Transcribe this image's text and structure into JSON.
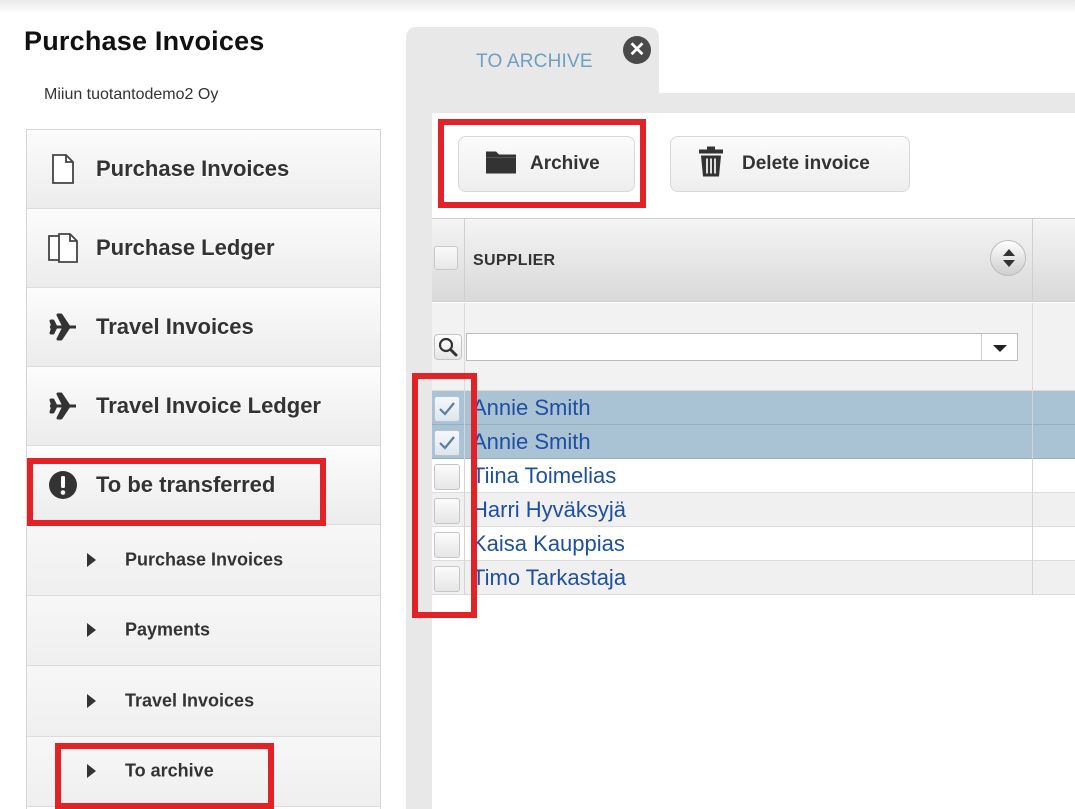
{
  "app": {
    "title": "Purchase Invoices",
    "company": "Miiun tuotantodemo2 Oy"
  },
  "sidebar": {
    "items": [
      {
        "label": "Purchase Invoices",
        "icon": "document-icon"
      },
      {
        "label": "Purchase Ledger",
        "icon": "documents-icon"
      },
      {
        "label": "Travel Invoices",
        "icon": "airplane-icon"
      },
      {
        "label": "Travel Invoice Ledger",
        "icon": "airplane-icon"
      },
      {
        "label": "To be transferred",
        "icon": "exclamation-icon"
      }
    ],
    "subitems": [
      {
        "label": "Purchase Invoices"
      },
      {
        "label": "Payments"
      },
      {
        "label": "Travel Invoices"
      },
      {
        "label": "To archive"
      }
    ]
  },
  "tab": {
    "label": "TO ARCHIVE",
    "close_glyph": "✕"
  },
  "toolbar": {
    "archive_label": "Archive",
    "delete_label": "Delete invoice"
  },
  "grid": {
    "column_header": "SUPPLIER",
    "filter_placeholder": "",
    "rows": [
      {
        "name": "Annie Smith",
        "checked": true
      },
      {
        "name": "Annie Smith",
        "checked": true
      },
      {
        "name": "Tiina Toimelias",
        "checked": false
      },
      {
        "name": "Harri Hyväksyjä",
        "checked": false
      },
      {
        "name": "Kaisa Kauppias",
        "checked": false
      },
      {
        "name": "Timo Tarkastaja",
        "checked": false
      }
    ]
  },
  "colors": {
    "highlight": "#e32227",
    "selected_row": "#a9c2d4",
    "link_text": "#1f4fa0",
    "tab_text": "#6fa0c0"
  }
}
